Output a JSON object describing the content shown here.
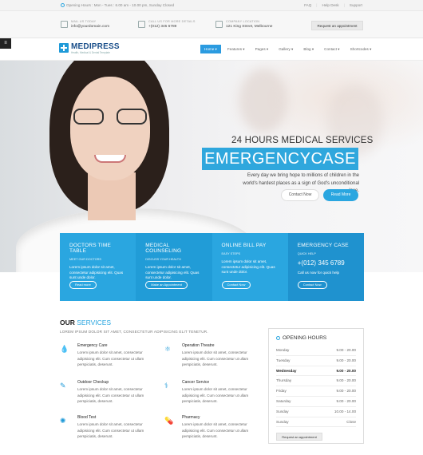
{
  "topbar": {
    "hours_text": "Opening Hours : Mon - Tues : 6.00 am - 10.00 pm, Sunday Closed",
    "links": [
      "FAQ",
      "Help Desk",
      "Support"
    ]
  },
  "contact": {
    "email_label": "MAIL US TODAY",
    "email_value": "info@yourdomain.com",
    "phone_label": "CALL US FOR MORE DETAILS",
    "phone_value": "+(012) 345 6789",
    "location_label": "COMPANY LOCATION",
    "location_value": "121 King Street, Melbourne",
    "appointment_button": "Request an appointment"
  },
  "nav": {
    "logo": "MEDIPRESS",
    "tagline": "Health, Medical & Dental Template",
    "items": [
      "Home",
      "Features",
      "Pages",
      "Gallery",
      "Blog",
      "Contact",
      "Shortcodes"
    ]
  },
  "hero": {
    "subtitle": "24 HOURS MEDICAL SERVICES",
    "title": "EMERGENCYCASE",
    "paragraph": "Every day we bring hope to millions of children in the world's hardest places as a sign of God's unconditional love.",
    "btn_contact": "Contact Now",
    "btn_read": "Read More"
  },
  "boxes": [
    {
      "title": "DOCTORS TIME TABLE",
      "sub": "MEET OUR DOCTORS",
      "text": "Lorem ipsum dolor sit amet, consectetur adipisicing elit. Quas sunt unde dolor.",
      "button": "Read more",
      "color": "#2aa6e0"
    },
    {
      "title": "MEDICAL COUNSELING",
      "sub": "DISCUSS YOUR HEALTH",
      "text": "Lorem ipsum dolor sit amet, consectetur adipisicing elit. Quas sunt unde dolor.",
      "button": "Make an Appointment",
      "color": "#219cd7"
    },
    {
      "title": "ONLINE BILL PAY",
      "sub": "EASY STEPS",
      "text": "Lorem ipsum dolor sit amet, consectetur adipisicing elit. Quas sunt unde dolor.",
      "button": "Contact Now",
      "color": "#2aa6e0"
    },
    {
      "title": "EMERGENCY CASE",
      "sub": "QUICK HELP",
      "phone": "+(012) 345 6789",
      "text": "Call us now for quick help",
      "button": "Contact Now",
      "color": "#1f92cf"
    }
  ],
  "services": {
    "title_main": "OUR ",
    "title_accent": "SERVICES",
    "subtitle": "LOREM IPSUM DOLOR SIT AMET, CONSECTETUR ADIPISICING ELIT TENETUR.",
    "items": [
      {
        "name": "Emergency Care",
        "icon": "drop-icon",
        "text": "Lorem ipsum dolor sit amet, consectetur adipisicing elit. Cum consectetur ut ullam perspiciatis, deserunt."
      },
      {
        "name": "Operation Theatre",
        "icon": "molecule-icon",
        "text": "Lorem ipsum dolor sit amet, consectetur adipisicing elit. Cum consectetur ut ullam perspiciatis, deserunt."
      },
      {
        "name": "Outdoor Checkup",
        "icon": "syringe-icon",
        "text": "Lorem ipsum dolor sit amet, consectetur adipisicing elit. Cum consectetur ut ullam perspiciatis, deserunt."
      },
      {
        "name": "Cancer Service",
        "icon": "caduceus-icon",
        "text": "Lorem ipsum dolor sit amet, consectetur adipisicing elit. Cum consectetur ut ullam perspiciatis, deserunt."
      },
      {
        "name": "Blood Test",
        "icon": "virus-icon",
        "text": "Lorem ipsum dolor sit amet, consectetur adipisicing elit. Cum consectetur ut ullam perspiciatis, deserunt."
      },
      {
        "name": "Pharmacy",
        "icon": "pill-icon",
        "text": "Lorem ipsum dolor sit amet, consectetur adipisicing elit. Cum consectetur ut ullam perspiciatis, deserunt."
      }
    ]
  },
  "opening_hours": {
    "title": "OPENING HOURS",
    "rows": [
      {
        "day": "Monday",
        "time": "9.00 - 20.00"
      },
      {
        "day": "Tuesday",
        "time": "9.00 - 20.00"
      },
      {
        "day": "Wednesday",
        "time": "9.00 - 20.00",
        "today": true
      },
      {
        "day": "Thursday",
        "time": "9.00 - 20.00"
      },
      {
        "day": "Friday",
        "time": "9.00 - 20.00"
      },
      {
        "day": "Saturday",
        "time": "9.00 - 20.00"
      },
      {
        "day": "Sunday",
        "time": "10.00 - 14.00"
      },
      {
        "day": "Sunday",
        "time": "Close"
      }
    ],
    "button": "Request an appointment"
  }
}
